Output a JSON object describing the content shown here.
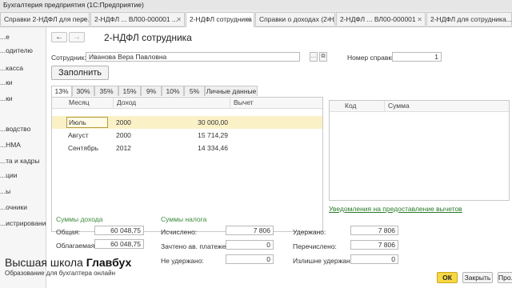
{
  "window": {
    "title": "Бухгалтерия предприятия  (1С:Предприятие)"
  },
  "tabs": [
    {
      "label": "Справки 2-НДФЛ для пере..."
    },
    {
      "label": "2-НДФЛ ... ВЛ00-000001 ..."
    },
    {
      "label": "2-НДФЛ сотрудника"
    },
    {
      "label": "Справки о доходах (2-НД..."
    },
    {
      "label": "2-НДФЛ ... ВЛ00-000001"
    },
    {
      "label": "2-НДФЛ для сотрудника..."
    }
  ],
  "sidebar": {
    "items": [
      "...е",
      "...одителю",
      "...касса",
      "...ки",
      "...ки",
      "...водство",
      "...НМА",
      "...та и кадры",
      "...ции",
      "...ы",
      "...очники",
      "...истрирование"
    ]
  },
  "form": {
    "title": "2-НДФЛ сотрудника",
    "employee_label": "Сотрудник:",
    "employee_value": "Иванова Вера Павловна",
    "number_label": "Номер справки:",
    "number_value": "1",
    "fill_button": "Заполнить",
    "rate_tabs": [
      "13%",
      "30%",
      "35%",
      "15%",
      "9%",
      "10%",
      "5%",
      "Личные данные"
    ],
    "income_grid": {
      "columns": [
        "Месяц",
        "Доход",
        "Вычет"
      ],
      "rows": [
        {
          "month": "Июль",
          "code": "2000",
          "amount": "30 000,00"
        },
        {
          "month": "Август",
          "code": "2000",
          "amount": "15 714,29"
        },
        {
          "month": "Сентябрь",
          "code": "2012",
          "amount": "14 334,46"
        }
      ]
    },
    "deduction_grid": {
      "columns": [
        "Код",
        "Сумма"
      ]
    },
    "notify_link": "Уведомления на предоставление вычетов",
    "income_sums": {
      "header": "Суммы дохода",
      "total_label": "Общая:",
      "total_value": "60 048,75",
      "taxable_label": "Облагаемая:",
      "taxable_value": "60 048,75"
    },
    "tax_sums": {
      "header": "Суммы налога",
      "calculated_label": "Исчислено:",
      "calculated_value": "7 806",
      "offset_label": "Зачтено ав. платежей:",
      "offset_value": "0",
      "not_withheld_label": "Не удержано:",
      "not_withheld_value": "0",
      "withheld_label": "Удержано:",
      "withheld_value": "7 806",
      "transferred_label": "Перечислено:",
      "transferred_value": "7 806",
      "excess_label": "Излишне удержано:",
      "excess_value": "0"
    },
    "buttons": {
      "ok": "ОК",
      "close": "Закрыть",
      "more": "Про..."
    }
  },
  "watermark": {
    "title_prefix": "Высшая школа ",
    "title_bold": "Главбух",
    "subtitle": "Образование для бухгалтера онлайн"
  },
  "colors": {
    "accent_yellow": "#f7d843",
    "selected_row": "#fbf1c7",
    "green_text": "#3d8a3d"
  }
}
